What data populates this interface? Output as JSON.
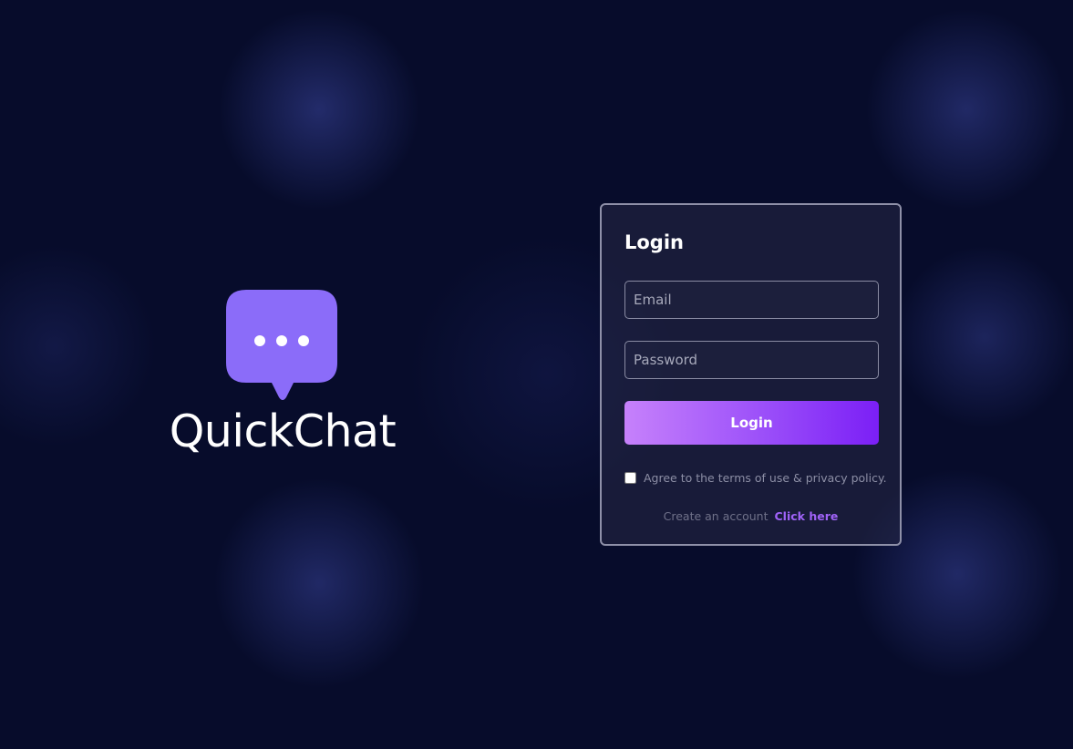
{
  "brand": {
    "name": "QuickChat",
    "logo_icon": "chat-bubble-icon",
    "logo_color": "#8b6cf9"
  },
  "login": {
    "title": "Login",
    "email_placeholder": "Email",
    "email_value": "",
    "password_placeholder": "Password",
    "password_value": "",
    "button_label": "Login",
    "terms_checked": false,
    "terms_label": "Agree to the terms of use & privacy policy.",
    "create_account_text": "Create an account",
    "create_account_link": "Click here"
  },
  "colors": {
    "background": "#070c2b",
    "accent": "#7b1ff6",
    "accent_light": "#c681fb",
    "link": "#a063f8"
  }
}
